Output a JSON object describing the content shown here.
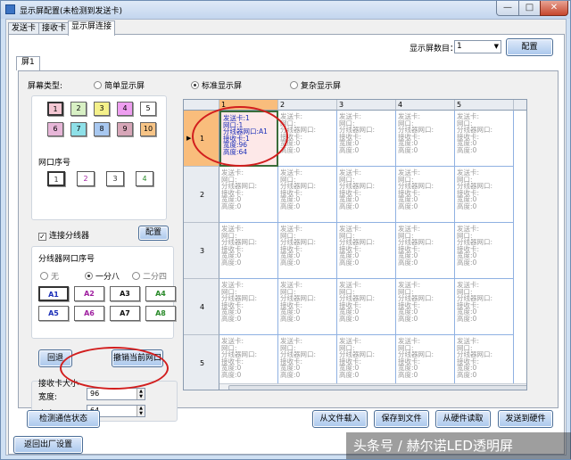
{
  "window": {
    "title": "显示屏配置(未检测到发送卡)",
    "min": "—",
    "max": "□",
    "close": "✕"
  },
  "tabs": [
    "发送卡",
    "接收卡",
    "显示屏连接"
  ],
  "screen_count": {
    "label": "显示屏数目：",
    "value": "1",
    "button": "配置"
  },
  "subtabs": [
    "屏1"
  ],
  "screen_type": {
    "label": "屏幕类型:",
    "options": [
      "简单显示屏",
      "标准显示屏",
      "复杂显示屏"
    ],
    "selected": "标准显示屏"
  },
  "color_boxes": [
    {
      "label": "1",
      "color": "#f4c7d3"
    },
    {
      "label": "2",
      "color": "#d8f0c4"
    },
    {
      "label": "3",
      "color": "#f4f08a"
    },
    {
      "label": "4",
      "color": "#ee9ef0"
    },
    {
      "label": "5",
      "color": "#ffffff"
    },
    {
      "label": "6",
      "color": "#e7b6d8"
    },
    {
      "label": "7",
      "color": "#8ee0e8"
    },
    {
      "label": "8",
      "color": "#a8c8f0"
    },
    {
      "label": "9",
      "color": "#d7a6b8"
    },
    {
      "label": "10",
      "color": "#f7c486"
    }
  ],
  "port_order": {
    "label": "网口序号",
    "ports": [
      "1",
      "2",
      "3",
      "4"
    ]
  },
  "splitter": {
    "checkbox_label": "连接分线器",
    "checked": true,
    "config_button": "配置"
  },
  "splitter_port": {
    "label": "分线器网口序号",
    "options": [
      "无",
      "一分八",
      "二分四"
    ],
    "selected": "一分八",
    "buttons": [
      "A1",
      "A2",
      "A3",
      "A4",
      "A5",
      "A6",
      "A7",
      "A8"
    ]
  },
  "actions": {
    "back": "回退",
    "cancel_port": "撤销当前网口"
  },
  "card_size": {
    "label": "接收卡大小",
    "width_label": "宽度:",
    "width": "96",
    "height_label": "高度:",
    "height": "64"
  },
  "grid": {
    "columns": [
      "1",
      "2",
      "3",
      "4",
      "5"
    ],
    "rows": [
      "1",
      "2",
      "3",
      "4",
      "5"
    ],
    "selected_cell": [
      "发送卡:1",
      "网口:1",
      "分线器网口:A1",
      "接收卡:1",
      "宽度:96",
      "高度:64"
    ],
    "empty_cell": [
      "发送卡:",
      "网口:",
      "分线器网口:",
      "接收卡:",
      "宽度:0",
      "高度:0"
    ]
  },
  "footer": {
    "check_comm": "检测通信状态",
    "load_file": "从文件载入",
    "save_file": "保存到文件",
    "read_hw": "从硬件读取",
    "send_hw": "发送到硬件",
    "factory": "返回出厂设置"
  },
  "watermark": "头条号 / 赫尔诺LED透明屏",
  "colors": {
    "highlight": "#f9bd7c",
    "annotation": "#d21e1e"
  }
}
